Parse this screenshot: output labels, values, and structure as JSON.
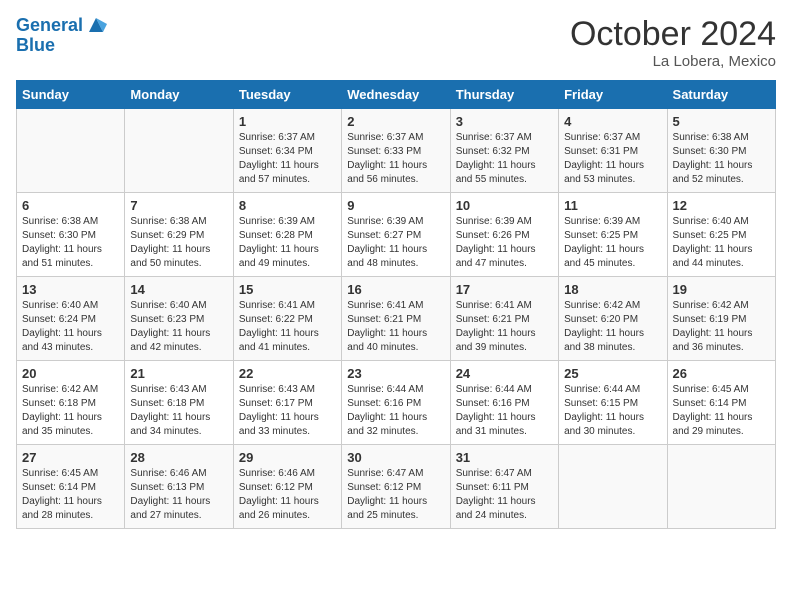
{
  "header": {
    "logo_line1": "General",
    "logo_line2": "Blue",
    "month": "October 2024",
    "location": "La Lobera, Mexico"
  },
  "weekdays": [
    "Sunday",
    "Monday",
    "Tuesday",
    "Wednesday",
    "Thursday",
    "Friday",
    "Saturday"
  ],
  "weeks": [
    [
      {
        "day": "",
        "info": ""
      },
      {
        "day": "",
        "info": ""
      },
      {
        "day": "1",
        "info": "Sunrise: 6:37 AM\nSunset: 6:34 PM\nDaylight: 11 hours and 57 minutes."
      },
      {
        "day": "2",
        "info": "Sunrise: 6:37 AM\nSunset: 6:33 PM\nDaylight: 11 hours and 56 minutes."
      },
      {
        "day": "3",
        "info": "Sunrise: 6:37 AM\nSunset: 6:32 PM\nDaylight: 11 hours and 55 minutes."
      },
      {
        "day": "4",
        "info": "Sunrise: 6:37 AM\nSunset: 6:31 PM\nDaylight: 11 hours and 53 minutes."
      },
      {
        "day": "5",
        "info": "Sunrise: 6:38 AM\nSunset: 6:30 PM\nDaylight: 11 hours and 52 minutes."
      }
    ],
    [
      {
        "day": "6",
        "info": "Sunrise: 6:38 AM\nSunset: 6:30 PM\nDaylight: 11 hours and 51 minutes."
      },
      {
        "day": "7",
        "info": "Sunrise: 6:38 AM\nSunset: 6:29 PM\nDaylight: 11 hours and 50 minutes."
      },
      {
        "day": "8",
        "info": "Sunrise: 6:39 AM\nSunset: 6:28 PM\nDaylight: 11 hours and 49 minutes."
      },
      {
        "day": "9",
        "info": "Sunrise: 6:39 AM\nSunset: 6:27 PM\nDaylight: 11 hours and 48 minutes."
      },
      {
        "day": "10",
        "info": "Sunrise: 6:39 AM\nSunset: 6:26 PM\nDaylight: 11 hours and 47 minutes."
      },
      {
        "day": "11",
        "info": "Sunrise: 6:39 AM\nSunset: 6:25 PM\nDaylight: 11 hours and 45 minutes."
      },
      {
        "day": "12",
        "info": "Sunrise: 6:40 AM\nSunset: 6:25 PM\nDaylight: 11 hours and 44 minutes."
      }
    ],
    [
      {
        "day": "13",
        "info": "Sunrise: 6:40 AM\nSunset: 6:24 PM\nDaylight: 11 hours and 43 minutes."
      },
      {
        "day": "14",
        "info": "Sunrise: 6:40 AM\nSunset: 6:23 PM\nDaylight: 11 hours and 42 minutes."
      },
      {
        "day": "15",
        "info": "Sunrise: 6:41 AM\nSunset: 6:22 PM\nDaylight: 11 hours and 41 minutes."
      },
      {
        "day": "16",
        "info": "Sunrise: 6:41 AM\nSunset: 6:21 PM\nDaylight: 11 hours and 40 minutes."
      },
      {
        "day": "17",
        "info": "Sunrise: 6:41 AM\nSunset: 6:21 PM\nDaylight: 11 hours and 39 minutes."
      },
      {
        "day": "18",
        "info": "Sunrise: 6:42 AM\nSunset: 6:20 PM\nDaylight: 11 hours and 38 minutes."
      },
      {
        "day": "19",
        "info": "Sunrise: 6:42 AM\nSunset: 6:19 PM\nDaylight: 11 hours and 36 minutes."
      }
    ],
    [
      {
        "day": "20",
        "info": "Sunrise: 6:42 AM\nSunset: 6:18 PM\nDaylight: 11 hours and 35 minutes."
      },
      {
        "day": "21",
        "info": "Sunrise: 6:43 AM\nSunset: 6:18 PM\nDaylight: 11 hours and 34 minutes."
      },
      {
        "day": "22",
        "info": "Sunrise: 6:43 AM\nSunset: 6:17 PM\nDaylight: 11 hours and 33 minutes."
      },
      {
        "day": "23",
        "info": "Sunrise: 6:44 AM\nSunset: 6:16 PM\nDaylight: 11 hours and 32 minutes."
      },
      {
        "day": "24",
        "info": "Sunrise: 6:44 AM\nSunset: 6:16 PM\nDaylight: 11 hours and 31 minutes."
      },
      {
        "day": "25",
        "info": "Sunrise: 6:44 AM\nSunset: 6:15 PM\nDaylight: 11 hours and 30 minutes."
      },
      {
        "day": "26",
        "info": "Sunrise: 6:45 AM\nSunset: 6:14 PM\nDaylight: 11 hours and 29 minutes."
      }
    ],
    [
      {
        "day": "27",
        "info": "Sunrise: 6:45 AM\nSunset: 6:14 PM\nDaylight: 11 hours and 28 minutes."
      },
      {
        "day": "28",
        "info": "Sunrise: 6:46 AM\nSunset: 6:13 PM\nDaylight: 11 hours and 27 minutes."
      },
      {
        "day": "29",
        "info": "Sunrise: 6:46 AM\nSunset: 6:12 PM\nDaylight: 11 hours and 26 minutes."
      },
      {
        "day": "30",
        "info": "Sunrise: 6:47 AM\nSunset: 6:12 PM\nDaylight: 11 hours and 25 minutes."
      },
      {
        "day": "31",
        "info": "Sunrise: 6:47 AM\nSunset: 6:11 PM\nDaylight: 11 hours and 24 minutes."
      },
      {
        "day": "",
        "info": ""
      },
      {
        "day": "",
        "info": ""
      }
    ]
  ]
}
